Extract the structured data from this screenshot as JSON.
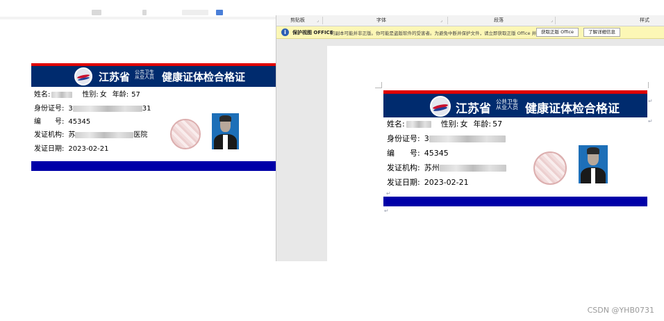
{
  "word": {
    "ribbon_groups": [
      "剪贴板",
      "字体",
      "段落",
      "样式"
    ],
    "message_bar": {
      "title": "保护视图 OFFICE",
      "text": "的副本可能并非正版。你可能是盗版软件的受害者。为避免中断并保护文件，请立即获取正版 Office 并保持文件安全。",
      "buttons": [
        "获取正版 Office",
        "了解详细信息"
      ]
    }
  },
  "card": {
    "province": "江苏省",
    "sub_title_line1": "公共卫生",
    "sub_title_line2": "从业人员",
    "main_title": "健康证体检合格证",
    "name_label": "姓名:",
    "gender_label": "性别:",
    "gender_value": "女",
    "age_label": "年龄:",
    "age_value": "57",
    "id_label": "身份证号:",
    "id_prefix": "3",
    "id_suffix_left": "31",
    "number_label": "编　　号:",
    "number_value": "45345",
    "issuer_label": "发证机构:",
    "issuer_prefix_left": "苏",
    "issuer_suffix_left": "医院",
    "issuer_prefix_right": "苏州",
    "date_label": "发证日期:",
    "date_value": "2023-02-21"
  },
  "watermark": "CSDN @YHB0731"
}
